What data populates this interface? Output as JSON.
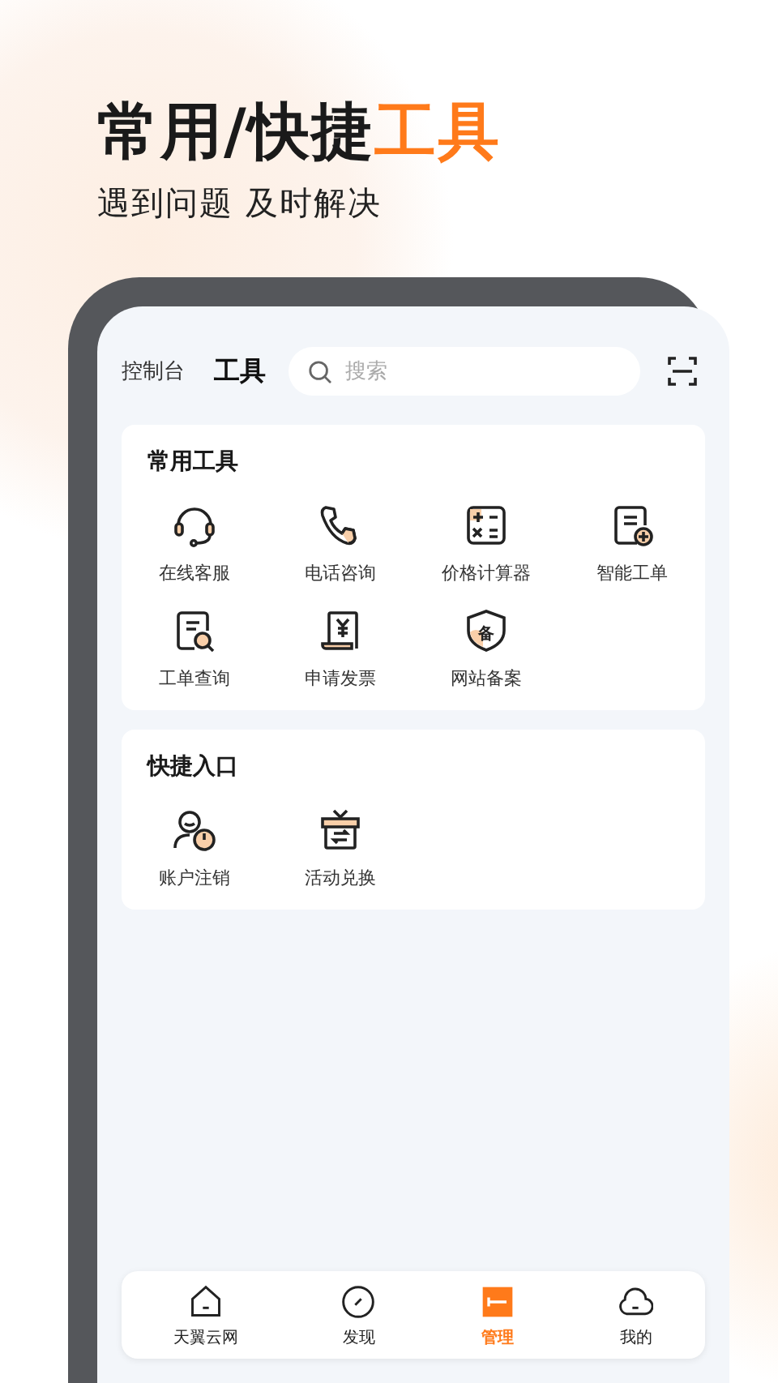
{
  "headline": [
    {
      "text": "常用/快捷",
      "highlight": false
    },
    {
      "text": "工具",
      "highlight": true
    }
  ],
  "subtitle": "遇到问题 及时解决",
  "tabs": [
    {
      "label": "控制台",
      "selected": false
    },
    {
      "label": "工具",
      "selected": true
    }
  ],
  "search": {
    "placeholder": "搜索"
  },
  "sections": [
    {
      "title": "常用工具",
      "items": [
        {
          "label": "在线客服",
          "kind": "headset"
        },
        {
          "label": "电话咨询",
          "kind": "phone"
        },
        {
          "label": "价格计算器",
          "kind": "calculator"
        },
        {
          "label": "智能工单",
          "kind": "ticket-add"
        },
        {
          "label": "工单查询",
          "kind": "ticket-search"
        },
        {
          "label": "申请发票",
          "kind": "invoice"
        },
        {
          "label": "网站备案",
          "kind": "shield",
          "icon_text": "备"
        }
      ]
    },
    {
      "title": "快捷入口",
      "items": [
        {
          "label": "账户注销",
          "kind": "user-power"
        },
        {
          "label": "活动兑换",
          "kind": "gift"
        }
      ]
    }
  ],
  "bottom_nav": [
    {
      "label": "天翼云网",
      "kind": "home",
      "selected": false
    },
    {
      "label": "发现",
      "kind": "compass",
      "selected": false
    },
    {
      "label": "管理",
      "kind": "manage",
      "selected": true
    },
    {
      "label": "我的",
      "kind": "cloud",
      "selected": false
    }
  ]
}
